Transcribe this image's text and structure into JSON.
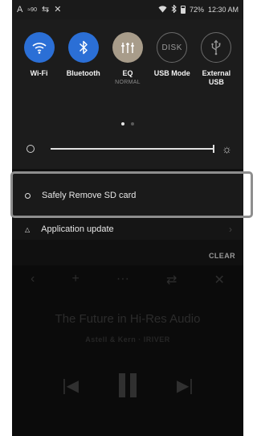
{
  "status_bar": {
    "left_icons": [
      "A",
      "≈90",
      "⇆",
      "✕"
    ],
    "wifi_icon": "wifi-icon",
    "bluetooth_icon": "bluetooth-icon",
    "battery_percent": "72%",
    "time": "12:30 AM"
  },
  "quick_settings": {
    "toggles": [
      {
        "label": "Wi-Fi",
        "icon": "wifi-icon",
        "state": "on",
        "color": "#2b6fd6"
      },
      {
        "label": "Bluetooth",
        "icon": "bluetooth-icon",
        "state": "on",
        "color": "#2b6fd6"
      },
      {
        "label": "EQ",
        "sublabel": "NORMAL",
        "icon": "eq-icon",
        "state": "on",
        "color": "#a89c8a"
      },
      {
        "label": "USB Mode",
        "icon_text": "DISK",
        "icon": "disk-icon",
        "state": "off"
      },
      {
        "label": "External\nUSB",
        "icon": "usb-icon",
        "state": "off"
      }
    ],
    "page_count": 2,
    "active_page": 0,
    "brightness_level": 1.0
  },
  "notifications": [
    {
      "text": "Safely Remove SD card",
      "icon": "sd-card-icon"
    },
    {
      "text": "Application update",
      "icon": "warning-triangle-icon"
    }
  ],
  "clear_label": "CLEAR",
  "player": {
    "title": "The Future in Hi-Res Audio",
    "artist_line": "Astell & Kern  ·  IRIVER"
  },
  "colors": {
    "accent_blue": "#2b6fd6",
    "eq_gold": "#a89c8a",
    "highlight_frame": "#8e8e8e"
  }
}
